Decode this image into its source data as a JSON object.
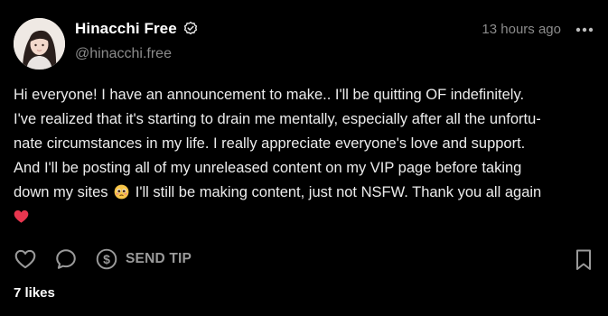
{
  "post": {
    "author": {
      "display_name": "Hinacchi Free",
      "handle": "@hinacchi.free",
      "verified": true
    },
    "timestamp": "13 hours ago",
    "text_lines": [
      "Hi everyone! I have an announcement to make.. I'll be quitting OF indefinitely.",
      "I've realized that it's starting to drain me mentally, especially after all the unfortu-",
      "nate circumstances in my life. I really appreciate everyone's love and support.",
      "And I'll be posting all of my unreleased content on my VIP page before taking"
    ],
    "text_line5_before_emoji": "down my sites",
    "text_line5_after_emoji": "I'll still be making content, just not NSFW. Thank you all again",
    "actions": {
      "tip_label": "SEND TIP"
    },
    "likes_text": "7 likes"
  },
  "icons": {
    "more": "more-horizontal-icon",
    "verified": "verified-check-icon",
    "like": "heart-outline-icon",
    "comment": "speech-bubble-icon",
    "tip": "dollar-circle-icon",
    "bookmark": "bookmark-icon",
    "emoji_1": "pleading-face-emoji",
    "emoji_2": "red-heart-emoji"
  },
  "colors": {
    "background": "#000000",
    "primary_text": "#ececec",
    "secondary_text": "#8b8b8b",
    "heart_emoji": "#e8364f"
  }
}
